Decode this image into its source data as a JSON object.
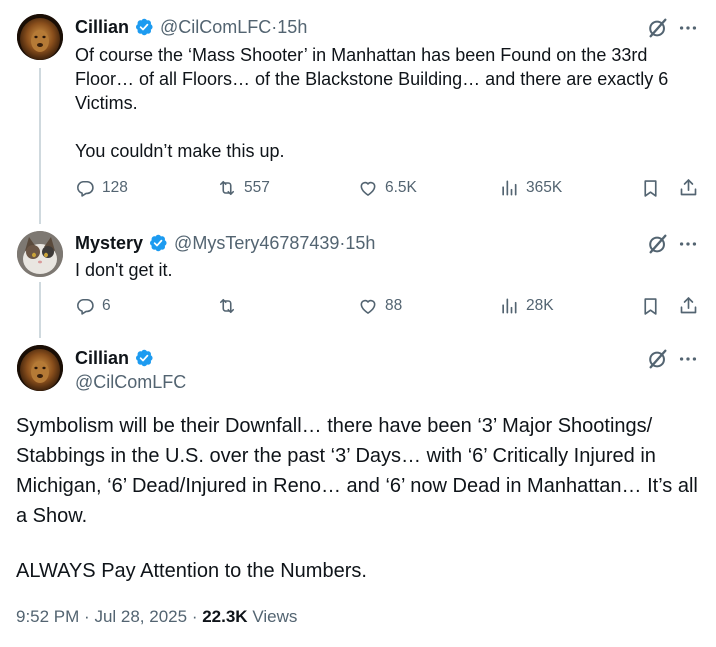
{
  "tweets": [
    {
      "name": "Cillian",
      "handle": "@CilComLFC",
      "dot": " · ",
      "time": "15h",
      "paragraph1": "Of course the ‘Mass Shooter’ in Manhattan has been Found on the 33rd Floor… of all Floors… of the Blackstone Building… and there are exactly 6 Victims.",
      "paragraph2": "You couldn’t make this up.",
      "replies": "128",
      "reposts": "557",
      "likes": "6.5K",
      "views": "365K"
    },
    {
      "name": "Mystery",
      "handle": "@MysTery46787439",
      "dot": " · ",
      "time": "15h",
      "text": "I don't get it.",
      "replies": "6",
      "reposts": "",
      "likes": "88",
      "views": "28K"
    }
  ],
  "main": {
    "name": "Cillian",
    "handle": "@CilComLFC",
    "paragraph1": "Symbolism will be their Downfall… there have been ‘3’ Major Shootings/ Stabbings in the U.S. over the past ‘3’ Days… with ‘6’ Critically Injured in Michigan, ‘6’ Dead/Injured in Reno… and ‘6’ now Dead in Manhattan… It’s all a Show.",
    "paragraph2": "ALWAYS Pay Attention to the Numbers.",
    "time": "9:52 PM",
    "date": "Jul 28, 2025",
    "views_count": "22.3K",
    "views_label": "Views"
  },
  "colors": {
    "verified": "#1d9bf0",
    "secondary_text": "#536471",
    "primary_text": "#0f1419",
    "thread_line": "#cfd9de"
  },
  "icons": [
    "verified-badge-icon",
    "grok-icon",
    "more-icon",
    "reply-icon",
    "repost-icon",
    "like-icon",
    "views-icon",
    "bookmark-icon",
    "share-icon"
  ]
}
